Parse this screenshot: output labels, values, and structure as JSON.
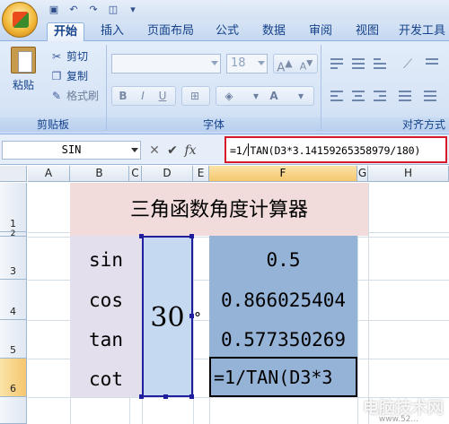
{
  "quick_access": {
    "icons": [
      "save-icon",
      "undo-icon",
      "redo-icon",
      "screenshot-icon",
      "customize-icon"
    ]
  },
  "ribbon_tabs": [
    "开始",
    "插入",
    "页面布局",
    "公式",
    "数据",
    "审阅",
    "视图",
    "开发工具"
  ],
  "active_tab": "开始",
  "clipboard": {
    "paste_label": "粘贴",
    "cut_label": "剪切",
    "copy_label": "复制",
    "format_painter_label": "格式刷",
    "group_label": "剪贴板"
  },
  "font": {
    "size_value": "18",
    "group_label": "字体",
    "bold": "B",
    "italic": "I",
    "underline": "U",
    "grow": "A",
    "shrink": "A"
  },
  "alignment": {
    "group_label": "对齐方式"
  },
  "formula_bar": {
    "name_box": "SIN",
    "formula_before_caret": "=1/",
    "formula_after_caret": "TAN(D3*3.14159265358979/180)"
  },
  "columns": [
    "A",
    "B",
    "C",
    "D",
    "E",
    "F",
    "G",
    "H"
  ],
  "selected_column": "F",
  "rows": [
    "1",
    "2",
    "3",
    "4",
    "5",
    "6"
  ],
  "selected_row": "6",
  "sheet": {
    "title": "三角函数角度计算器",
    "labels": [
      "sin",
      "cos",
      "tan",
      "cot"
    ],
    "angle": "30",
    "degree_symbol": "°",
    "values": [
      "0.5",
      "0.866025404",
      "0.577350269"
    ],
    "editing_text": "=1/TAN(D3*3"
  },
  "watermark": {
    "text": "电脑技术网",
    "sub": "www.52..."
  },
  "colors": {
    "title_fill": "#f2dcdb",
    "label_fill": "#e4dfec",
    "angle_fill": "#c5d9f1",
    "value_fill": "#95b3d7",
    "highlight_border": "#d7192a"
  }
}
